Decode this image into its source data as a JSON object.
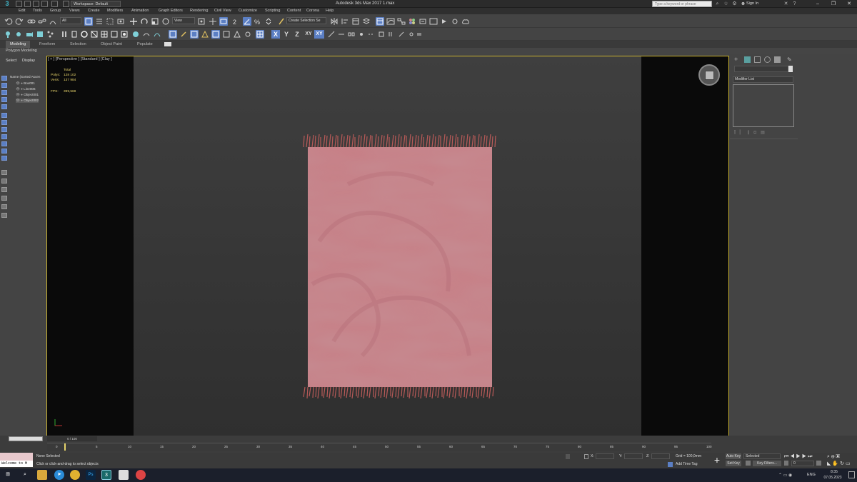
{
  "titlebar": {
    "workspace": "Workspace: Default",
    "app_title": "Autodesk 3ds Max 2017    1.max",
    "search_placeholder": "Type a keyword or phrase",
    "sign_in": "Sign In"
  },
  "menu": [
    "Edit",
    "Tools",
    "Group",
    "Views",
    "Create",
    "Modifiers",
    "Animation",
    "Graph Editors",
    "Rendering",
    "Civil View",
    "Customize",
    "Scripting",
    "Content",
    "Corona",
    "Help"
  ],
  "toolbar": {
    "selection_filter": "All",
    "ref_coord": "View",
    "named_selection": "Create Selection Se",
    "axes": [
      "X",
      "Y",
      "Z",
      "XY",
      "XY"
    ]
  },
  "ribbon": {
    "tabs": [
      "Modeling",
      "Freeform",
      "Selection",
      "Object Paint",
      "Populate"
    ],
    "active_tab": "Modeling",
    "sub": "Polygon Modeling"
  },
  "scene_explorer": {
    "tabs": [
      "Select",
      "Display"
    ],
    "header": "Name (Sorted Ascen",
    "items": [
      "Box001",
      "Line006",
      "Object001",
      "Object002"
    ]
  },
  "viewport": {
    "label": "[ + ] [Perspective ] [Standard ] [Clay ]",
    "stats_title": "Total",
    "polys_label": "Polys:",
    "polys_value": "128 102",
    "verts_label": "Verts:",
    "verts_value": "137 984",
    "fps_label": "FPS:",
    "fps_value": "399,568"
  },
  "command_panel": {
    "modifier_list": "Modifier List"
  },
  "timeline": {
    "frame": "0 / 100",
    "ticks": [
      "0",
      "5",
      "10",
      "15",
      "20",
      "25",
      "30",
      "35",
      "40",
      "45",
      "50",
      "55",
      "60",
      "65",
      "70",
      "75",
      "80",
      "85",
      "90",
      "95",
      "100"
    ]
  },
  "status": {
    "listener": "Welcome to M",
    "selection": "None Selected",
    "prompt": "Click or click-and-drag to select objects",
    "x_label": "X:",
    "y_label": "Y:",
    "z_label": "Z:",
    "grid": "Grid = 100,0mm",
    "add_time_tag": "Add Time Tag",
    "auto_key": "Auto Key",
    "set_key": "Set Key",
    "selected": "Selected",
    "key_filters": "Key Filters...",
    "frame_field": "0"
  },
  "taskbar": {
    "lang": "ENG",
    "time": "8:35",
    "date": "07.05.2023"
  },
  "colors": {
    "rug": "#c77f86",
    "fringe": "#b85a58",
    "accent": "#5b7fc4",
    "viewport_border": "#c9b230"
  }
}
